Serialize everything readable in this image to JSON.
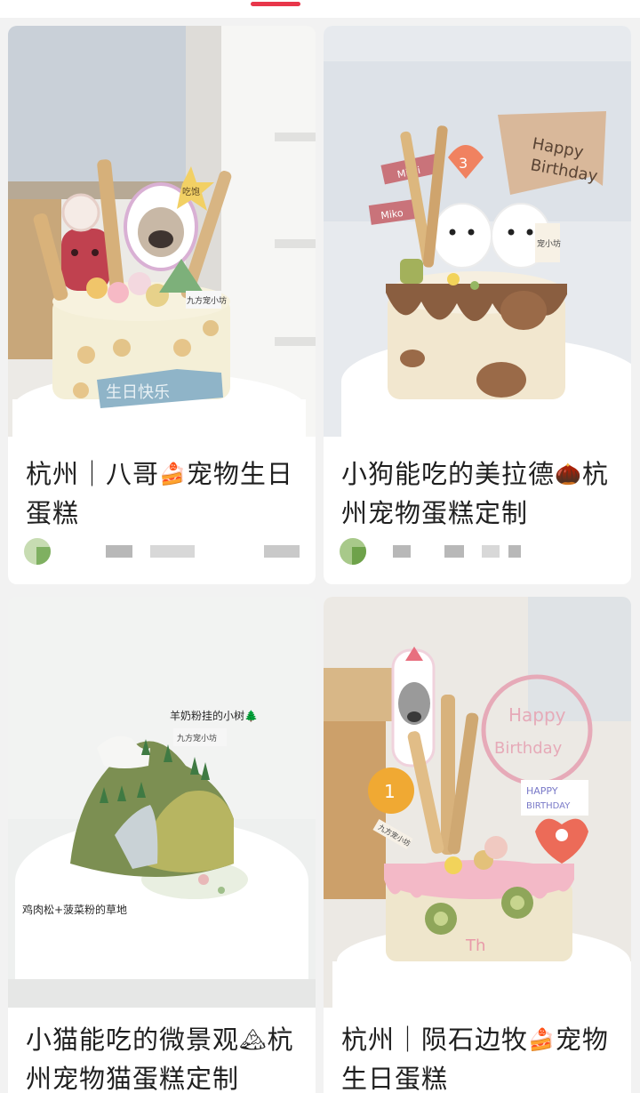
{
  "tab_indicator_color": "#e8364a",
  "cards": [
    {
      "title_before": "杭州｜八哥",
      "title_emoji": "🍰",
      "title_after": "宠物生日蛋糕",
      "photo_text": {
        "topper": "吃饱",
        "plaque": "生日快乐",
        "card": "九方宠小坊"
      }
    },
    {
      "title_before": "小狗能吃的美拉德",
      "title_emoji": "🌰",
      "title_after": "杭州宠物蛋糕定制",
      "photo_text": {
        "flag1": "Happy",
        "flag2": "Birthday",
        "tag1": "Mimi",
        "tag2": "Miko",
        "balloon": "3",
        "card": "宠小坊"
      }
    },
    {
      "title_before": "小猫能吃的微景观",
      "title_emoji": "🏔",
      "title_after": "杭州宠物猫蛋糕定制",
      "photo_text": {
        "label_top": "羊奶粉挂的小树🌲",
        "label_bottom": "鸡肉松+菠菜粉的草地",
        "card": "九方宠小坊"
      }
    },
    {
      "title_before": "杭州｜陨石边牧",
      "title_emoji": "🍰",
      "title_after": "宠物生日蛋糕",
      "photo_text": {
        "topper1": "Happy",
        "topper2": "Birthday",
        "card1": "HAPPY",
        "card2": "BIRTHDAY",
        "balloon": "1",
        "sign": "九方宠小坊"
      }
    }
  ]
}
